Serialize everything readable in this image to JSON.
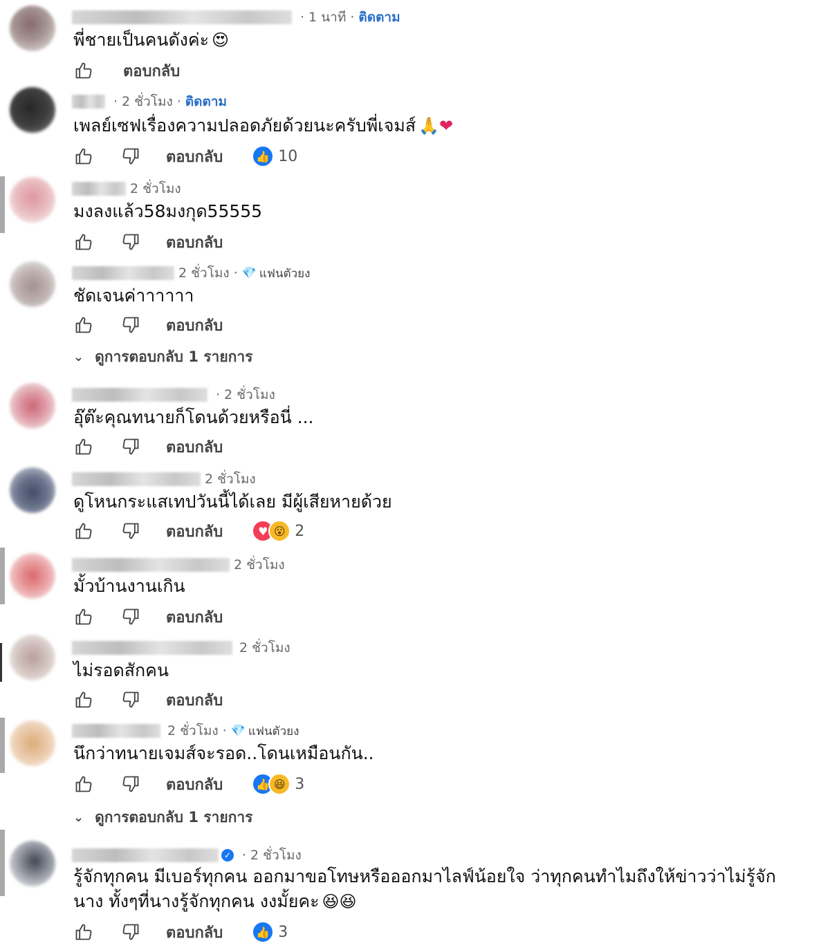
{
  "labels": {
    "reply": "ตอบกลับ"
  },
  "comments": [
    {
      "time": "1 นาที",
      "follow": "ติดตาม",
      "text": "พี่ชายเป็นคนดังค่ะ",
      "emoji": "😍"
    },
    {
      "time": "2 ชั่วโมง",
      "follow": "ติดตาม",
      "text": "เพลย์เซฟเรื่องความปลอดภัยด้วยนะครับพี่เจมส์",
      "emoji": "🙏❤",
      "reaction_count": "10"
    },
    {
      "time": "2 ชั่วโมง",
      "text": "มงลงแล้ว58มงกุด55555"
    },
    {
      "time": "2 ชั่วโมง",
      "badge": "แฟนตัวยง",
      "text": "ชัดเจนค่าาาาาา",
      "view_replies": "ดูการตอบกลับ 1 รายการ"
    },
    {
      "time": "2 ชั่วโมง",
      "text": "อุ๊ต๊ะคุณทนายก็โดนด้วยหรือนี่ ..."
    },
    {
      "time": "2 ชั่วโมง",
      "text": "ดูโหนกระแสเทปวันนี้ได้เลย มีผู้เสียหายด้วย",
      "reaction_count": "2"
    },
    {
      "time": "2 ชั่วโมง",
      "text": "มั้วบ้านงานเกิน"
    },
    {
      "time": "2 ชั่วโมง",
      "text": "ไม่รอดสักคน"
    },
    {
      "time": "2 ชั่วโมง",
      "badge": "แฟนตัวยง",
      "text": "นึกว่าทนายเจมส์จะรอด..โดนเหมือนกัน..",
      "reaction_count": "3",
      "view_replies": "ดูการตอบกลับ 1 รายการ"
    },
    {
      "time": "2 ชั่วโมง",
      "text": "รู้จักทุกคน มีเบอร์ทุกคน ออกมาขอโทษหรือออกมาไลฟ์น้อยใจ ว่าทุกคนทำไมถึงให้ข่าวว่าไม่รู้จัก",
      "text2": "นาง ทั้งๆที่นางรู้จักทุกคน งงมั้ยคะ",
      "emoji": "😆😆",
      "reaction_count": "3"
    }
  ]
}
